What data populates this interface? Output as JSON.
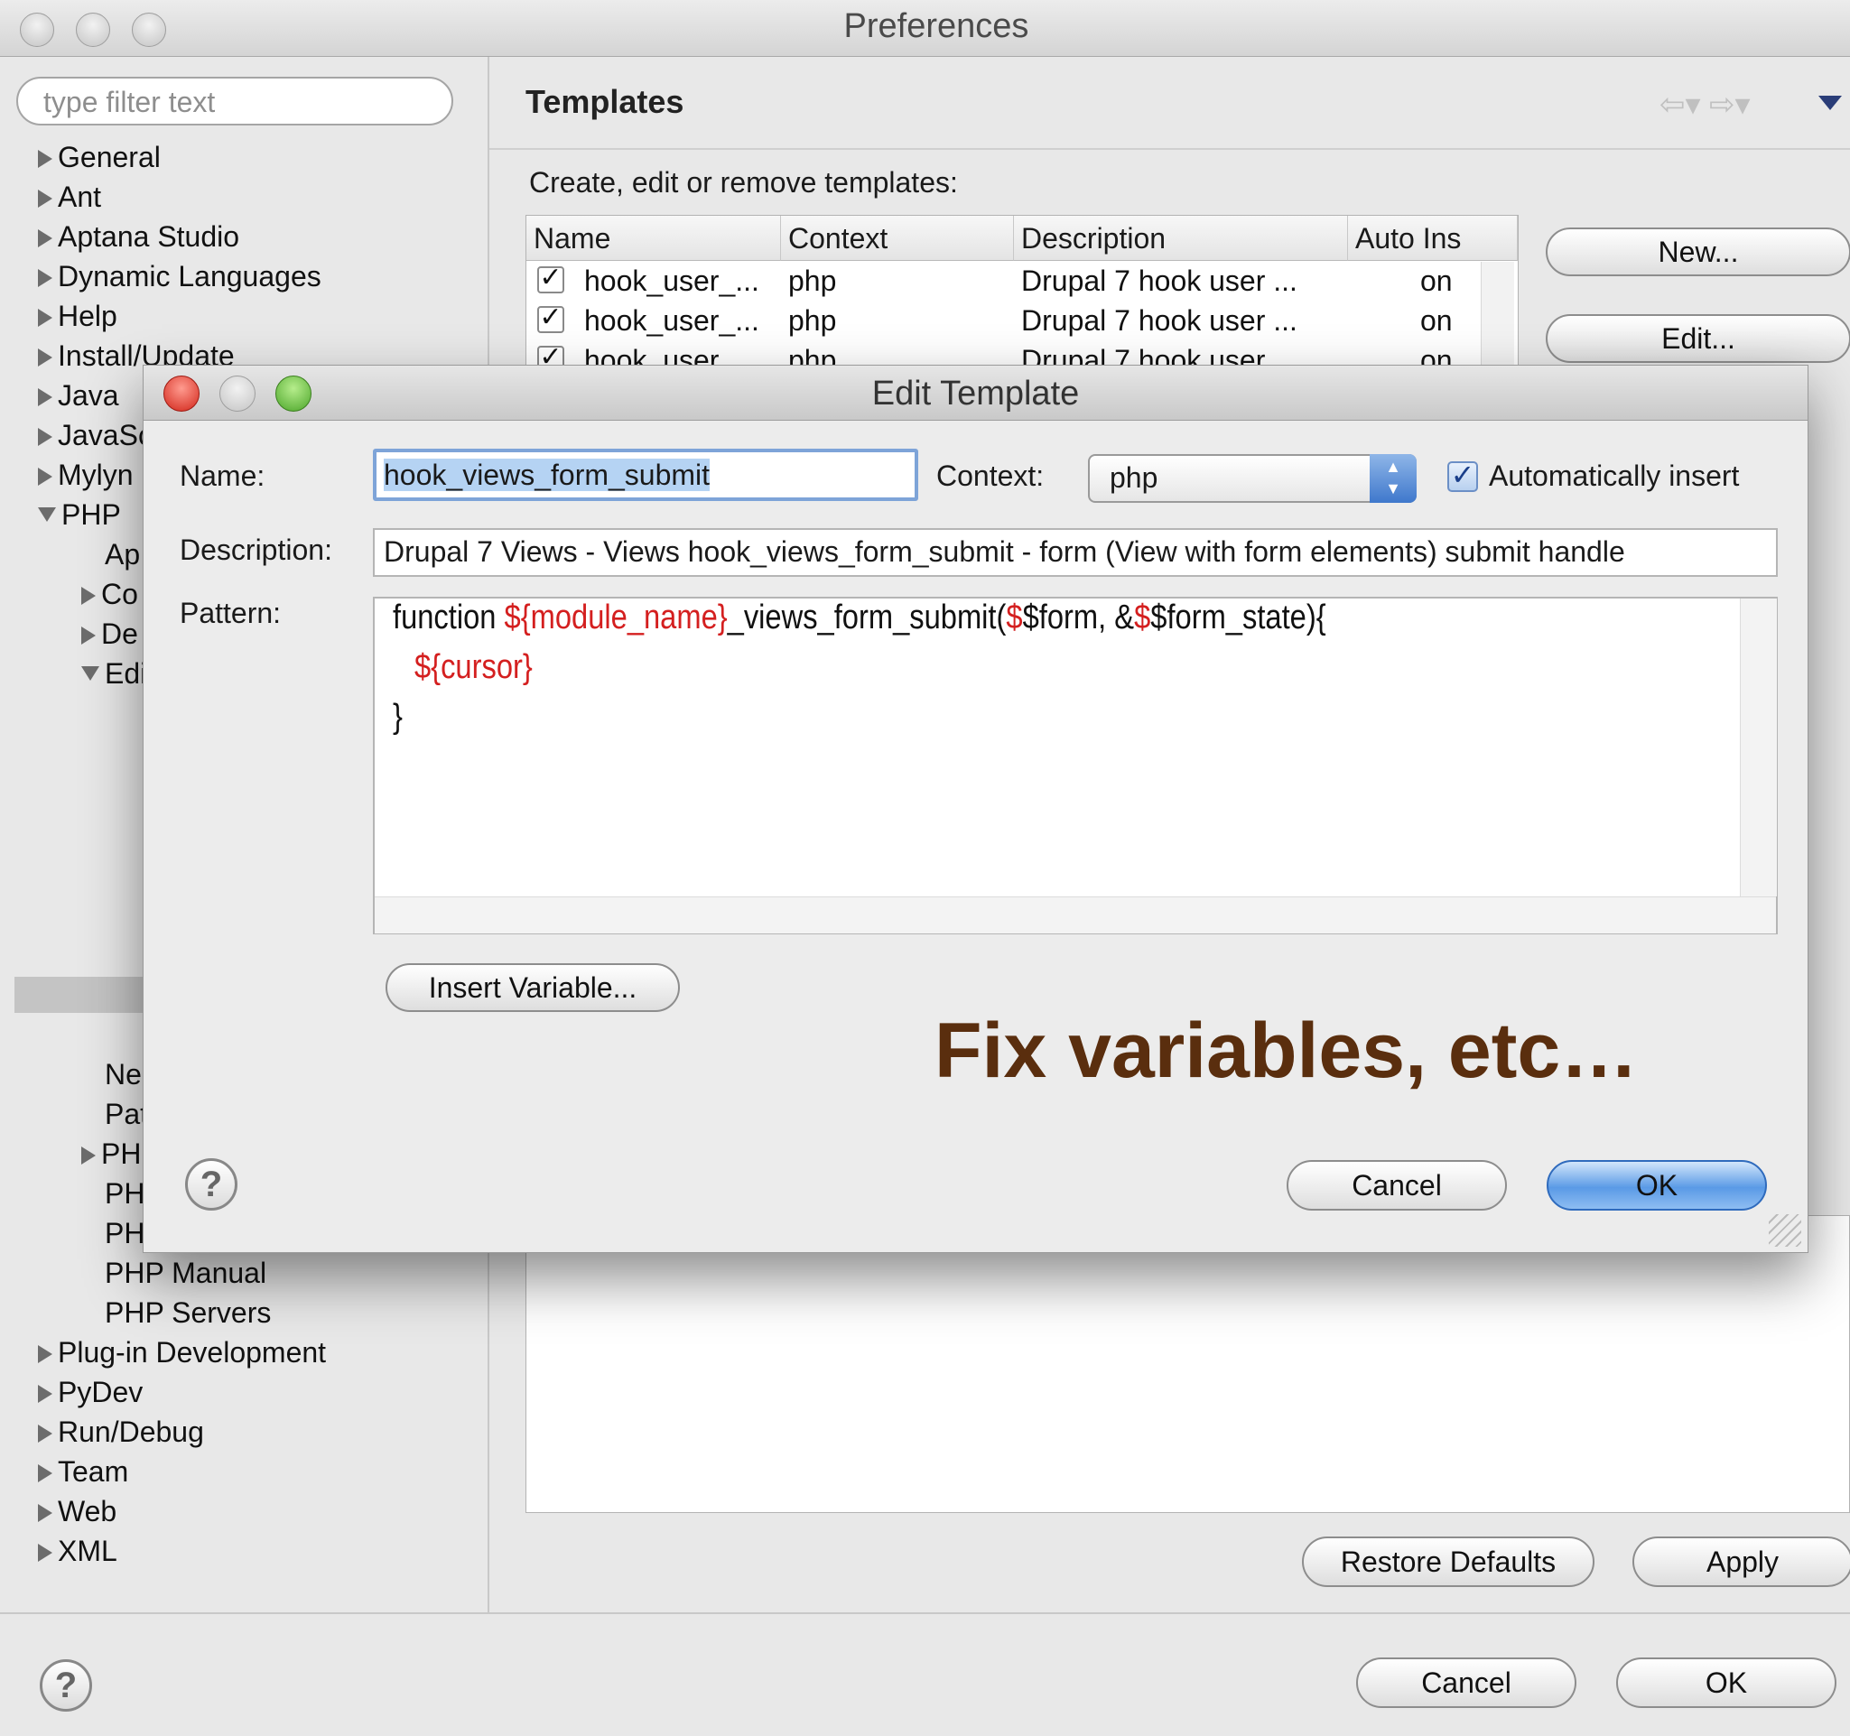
{
  "window": {
    "title": "Preferences"
  },
  "filter": {
    "placeholder": "type filter text"
  },
  "tree": {
    "top": [
      "General",
      "Ant",
      "Aptana Studio",
      "Dynamic Languages",
      "Help",
      "Install/Update",
      "Java",
      "JavaSc",
      "Mylyn",
      "PHP"
    ],
    "php_children": [
      "Ap",
      "Co",
      "De",
      "Edi"
    ],
    "php_lower": [
      "Ne",
      "Pat",
      "PH",
      "PH",
      "PH",
      "PHP Manual",
      "PHP Servers"
    ],
    "bottom": [
      "Plug-in Development",
      "PyDev",
      "Run/Debug",
      "Team",
      "Web",
      "XML"
    ]
  },
  "templates_page": {
    "heading": "Templates",
    "intro": "Create, edit or remove templates:",
    "columns": [
      "Name",
      "Context",
      "Description",
      "Auto Ins"
    ],
    "rows": [
      {
        "name": "hook_user_...",
        "context": "php",
        "description": "Drupal 7 hook user ...",
        "auto": "on"
      },
      {
        "name": "hook_user_...",
        "context": "php",
        "description": "Drupal 7 hook user ...",
        "auto": "on"
      },
      {
        "name": "hook_user_...",
        "context": "php",
        "description": "Drupal 7 hook user ...",
        "auto": "on"
      }
    ],
    "buttons": {
      "new": "New...",
      "edit": "Edit...",
      "restore_defaults": "Restore Defaults",
      "apply": "Apply"
    }
  },
  "footer": {
    "cancel": "Cancel",
    "ok": "OK"
  },
  "dialog": {
    "title": "Edit Template",
    "name_label": "Name:",
    "name_value": "hook_views_form_submit",
    "context_label": "Context:",
    "context_value": "php",
    "auto_insert_label": "Automatically insert",
    "auto_insert_checked": true,
    "description_label": "Description:",
    "description_value": "Drupal 7 Views - Views hook_views_form_submit - form (View with form elements) submit handle",
    "pattern_label": "Pattern:",
    "pattern": {
      "l1_a": "function ",
      "l1_b": "${module_name}",
      "l1_c": "_views_form_submit(",
      "l1_d": "$",
      "l1_e": "$form, &",
      "l1_f": "$",
      "l1_g": "$form_state){",
      "l2": "${cursor}",
      "l3": "}"
    },
    "insert_variable": "Insert Variable...",
    "cancel": "Cancel",
    "ok": "OK"
  },
  "annotation": "Fix variables, etc…",
  "colors": {
    "variable": "#d41f1f",
    "annotation": "#5a2e0e",
    "default_button": "#5a9ae6"
  }
}
